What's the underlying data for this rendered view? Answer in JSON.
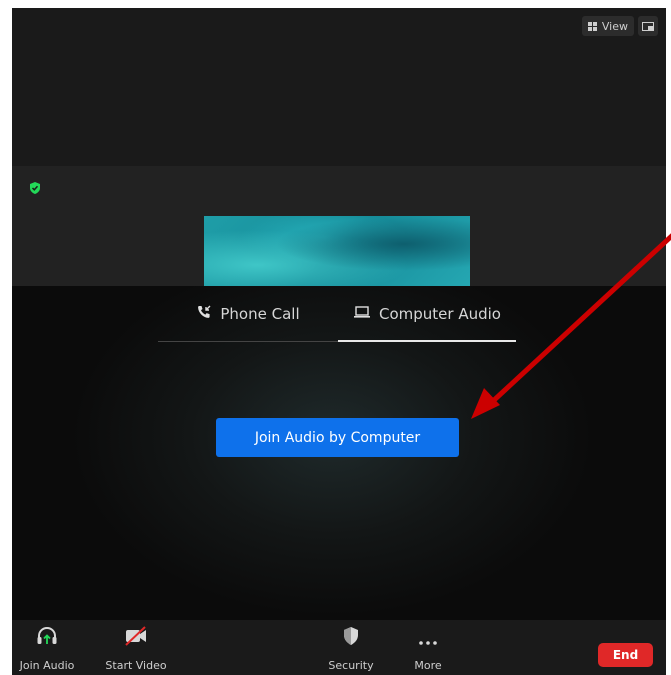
{
  "header": {
    "view_label": "View",
    "view_icon": "grid-icon",
    "fullscreen_icon": "minimize-window-icon"
  },
  "meeting": {
    "encryption_icon": "shield-check-icon",
    "encryption_color": "#23d959"
  },
  "audio_dialog": {
    "tabs": [
      {
        "label": "Phone Call",
        "icon": "phone-incoming-icon",
        "active": false
      },
      {
        "label": "Computer Audio",
        "icon": "laptop-icon",
        "active": true
      }
    ],
    "join_button_label": "Join Audio by Computer",
    "join_button_color": "#0e71eb"
  },
  "toolbar": {
    "join_audio_label": "Join Audio",
    "start_video_label": "Start Video",
    "security_label": "Security",
    "more_label": "More",
    "end_label": "End",
    "end_color": "#e02828"
  },
  "annotation": {
    "arrow_color": "#cc0000"
  }
}
